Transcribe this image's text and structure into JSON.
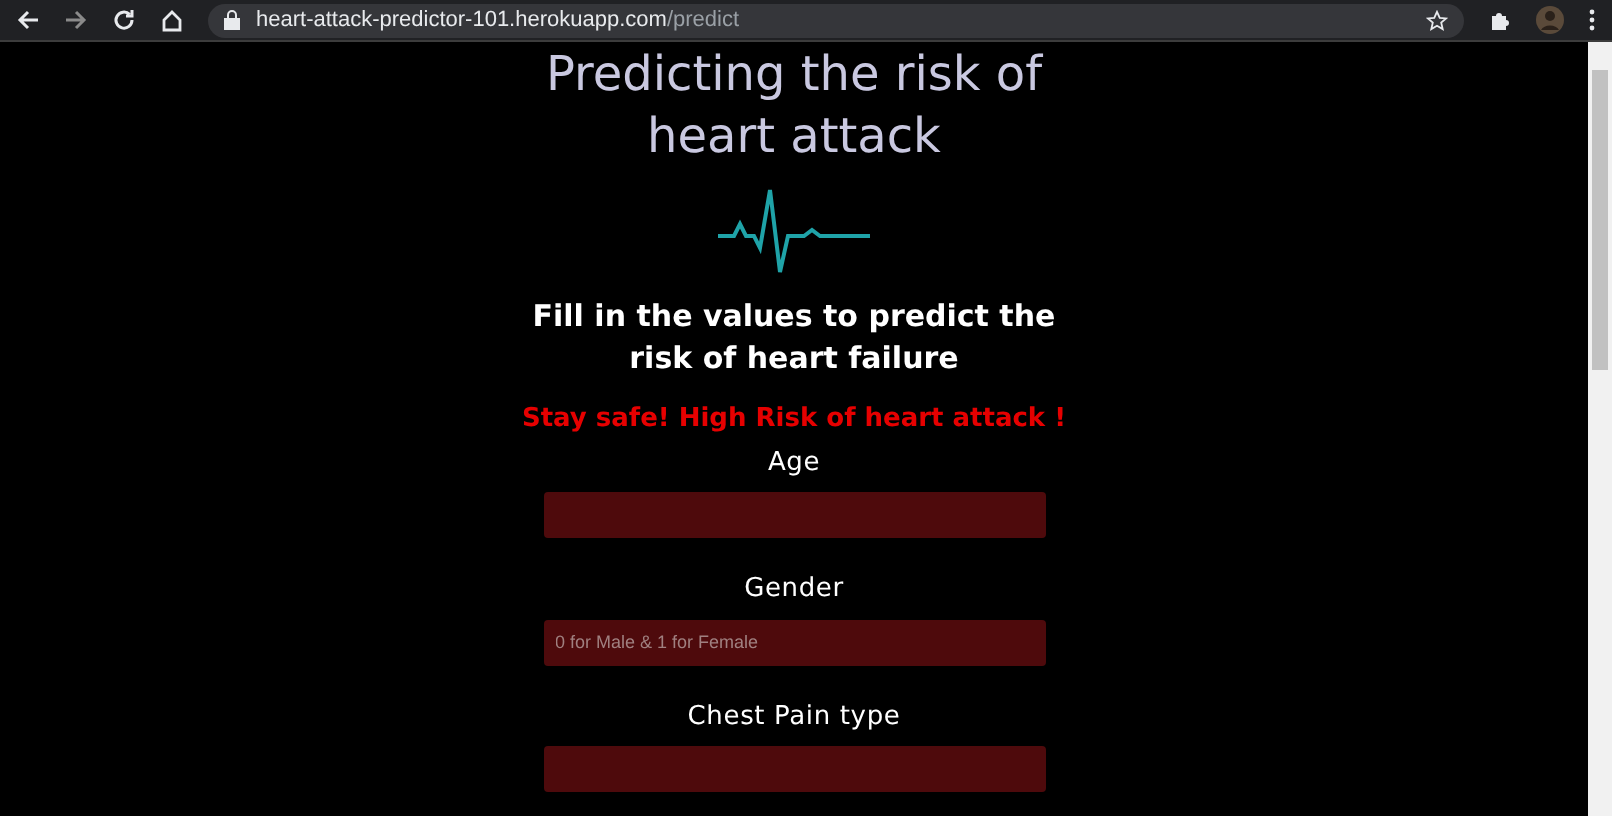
{
  "browser": {
    "url_host": "heart-attack-predictor-101.herokuapp.com",
    "url_path": "/predict"
  },
  "page": {
    "title": "Predicting the risk of heart attack",
    "subtitle": "Fill in the values to predict the risk of heart failure",
    "result": "Stay safe! High Risk of heart attack !",
    "fields": [
      {
        "label": "Age"
      },
      {
        "label": "Gender",
        "placeholder": "0 for Male & 1 for Female"
      },
      {
        "label": "Chest Pain type"
      }
    ]
  }
}
